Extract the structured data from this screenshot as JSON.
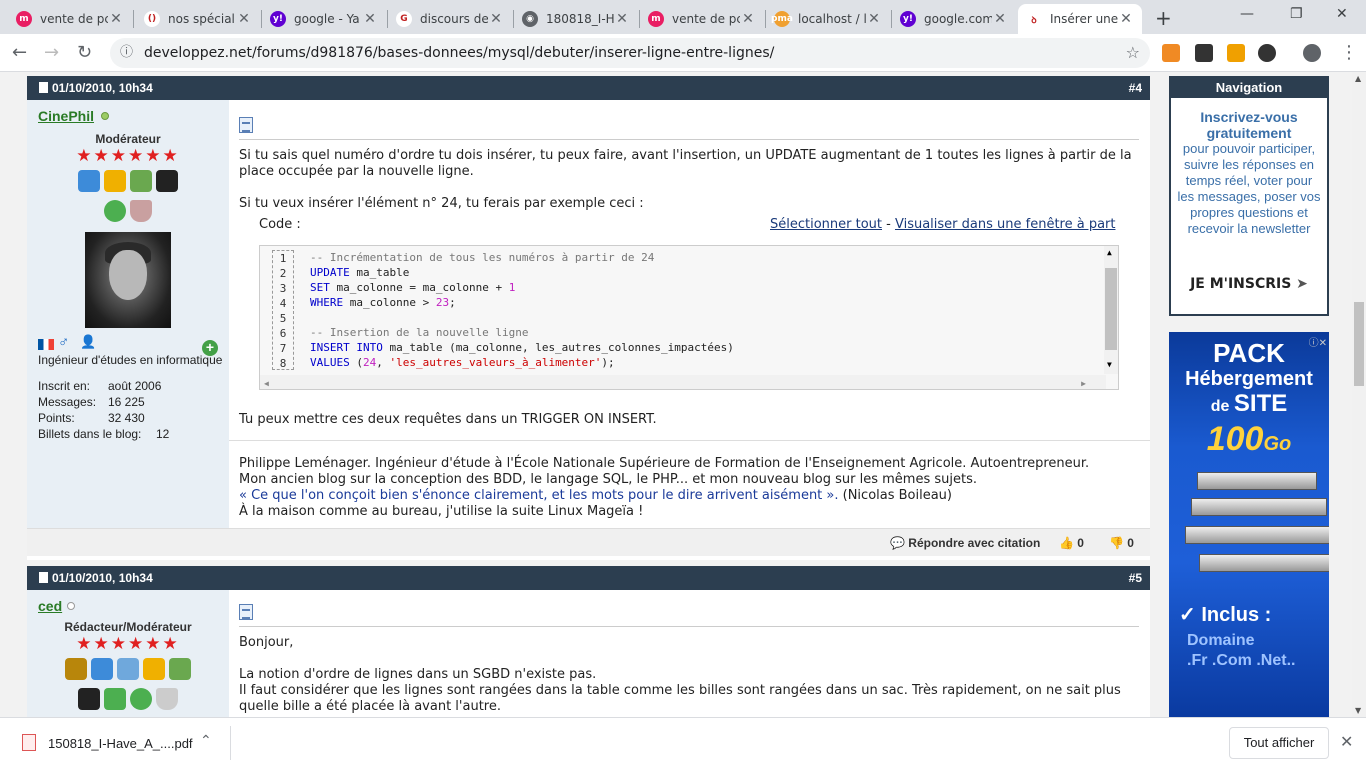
{
  "browser": {
    "tabs": [
      {
        "title": "vente de pc",
        "color": "#e91e63",
        "glyph": "m"
      },
      {
        "title": "nos spécialit",
        "color": "#ffffff",
        "glyph": "()"
      },
      {
        "title": "google - Ya",
        "color": "#6001d2",
        "glyph": "y!"
      },
      {
        "title": "discours de",
        "color": "#ffffff",
        "glyph": "G"
      },
      {
        "title": "180818_I-H",
        "color": "#5f6368",
        "glyph": "◉"
      },
      {
        "title": "vente de pc",
        "color": "#e91e63",
        "glyph": "m"
      },
      {
        "title": "localhost / l",
        "color": "#f0a030",
        "glyph": "pma"
      },
      {
        "title": "google.com",
        "color": "#6001d2",
        "glyph": "y!"
      },
      {
        "title": "Insérer une",
        "color": "#ffffff",
        "glyph": "ꝺ"
      }
    ],
    "url": "developpez.net/forums/d981876/bases-donnees/mysql/debuter/inserer-ligne-entre-lignes/"
  },
  "post4": {
    "date": "01/10/2010, 10h34",
    "number": "#4",
    "username": "CinePhil",
    "role": "Modérateur",
    "stars": "★★★★★★",
    "job": "Ingénieur d'études en informatique",
    "info": [
      {
        "label": "Inscrit en:",
        "value": "août 2006"
      },
      {
        "label": "Messages:",
        "value": "16 225"
      },
      {
        "label": "Points:",
        "value": "32 430"
      },
      {
        "label": "Billets dans le blog:",
        "value": "12"
      }
    ],
    "para1": "Si tu sais quel numéro d'ordre tu dois insérer, tu peux faire, avant l'insertion, un UPDATE augmentant de 1 toutes les lignes à partir de la place occupée par la nouvelle ligne.",
    "para2": "Si tu veux insérer l'élément n° 24, tu ferais par exemple ceci :",
    "code_label": "Code :",
    "select_all": "Sélectionner tout",
    "dash": " - ",
    "open_window": "Visualiser dans une fenêtre à part",
    "code_lines": [
      {
        "n": "1",
        "t": "-- Incrémentation de tous les numéros à partir de 24"
      },
      {
        "n": "2",
        "t": "UPDATE ma_table"
      },
      {
        "n": "3",
        "t": "SET ma_colonne = ma_colonne + 1"
      },
      {
        "n": "4",
        "t": "WHERE ma_colonne > 23;"
      },
      {
        "n": "5",
        "t": ""
      },
      {
        "n": "6",
        "t": "-- Insertion de la nouvelle ligne"
      },
      {
        "n": "7",
        "t": "INSERT INTO ma_table (ma_colonne, les_autres_colonnes_impactées)"
      },
      {
        "n": "8",
        "t": "VALUES (24, 'les_autres_valeurs_à_alimenter');"
      }
    ],
    "para3": "Tu peux mettre ces deux requêtes dans un TRIGGER ON INSERT.",
    "sig1": "Philippe Leménager. Ingénieur d'étude à l'École Nationale Supérieure de Formation de l'Enseignement Agricole. Autoentrepreneur.",
    "sig2": "Mon ancien blog sur la conception des BDD, le langage SQL, le PHP... et mon nouveau blog sur les mêmes sujets.",
    "sig3_link": "« Ce que l'on conçoit bien s'énonce clairement, et les mots pour le dire arrivent aisément ».",
    "sig3_rest": " (Nicolas Boileau)",
    "sig4": "À la maison comme au bureau, j'utilise la suite Linux Mageïa !",
    "reply": "Répondre avec citation",
    "likes": "0",
    "dislikes": "0"
  },
  "post5": {
    "date": "01/10/2010, 10h34",
    "number": "#5",
    "username": "ced",
    "role": "Rédacteur/Modérateur",
    "stars": "★★★★★★",
    "p1": "Bonjour,",
    "p2": "La notion d'ordre de lignes dans un SGBD n'existe pas.",
    "p3": "Il faut considérer que les lignes sont rangées dans la table comme les billes sont rangées dans un sac. Très rapidement, on ne sait plus quelle bille a été placée là avant l'autre."
  },
  "sidebar": {
    "nav_title": "Navigation",
    "cta_bold": "Inscrivez-vous gratuitement",
    "cta_text": "pour pouvoir participer, suivre les réponses en temps réel, voter pour les messages, poser vos propres questions et recevoir la newsletter",
    "cta_button": "JE M'INSCRIS",
    "ad": {
      "l1": "PACK",
      "l2": "Hébergement",
      "l3a": "de ",
      "l3b": "SITE",
      "l4": "100",
      "l4u": "Go",
      "l5": "✓ Inclus :",
      "l6": "Domaine",
      "l7": ".Fr .Com .Net.."
    }
  },
  "downloads": {
    "file": "150818_I-Have_A_....pdf",
    "show_all": "Tout afficher"
  }
}
